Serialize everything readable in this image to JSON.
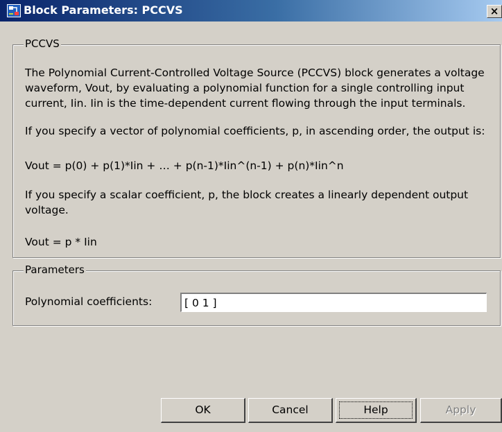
{
  "window": {
    "title": "Block Parameters: PCCVS",
    "close_glyph": "×"
  },
  "description_group": {
    "legend": "PCCVS",
    "lines": [
      "The Polynomial Current-Controlled Voltage Source (PCCVS) block generates a voltage",
      "waveform, Vout, by evaluating a polynomial function for a single controlling input",
      "current, Iin. Iin is the time-dependent current flowing through the input terminals.",
      "If you specify a vector of polynomial coefficients, p, in ascending order, the output is:",
      "Vout = p(0) + p(1)*Iin + … + p(n-1)*Iin^(n-1) +  p(n)*Iin^n",
      "If you specify a scalar coefficient, p, the block creates a linearly dependent output",
      "voltage.",
      "Vout = p * Iin"
    ]
  },
  "parameters_group": {
    "legend": "Parameters",
    "coeff_label": "Polynomial coefficients:",
    "coeff_value": "[ 0 1 ]"
  },
  "buttons": {
    "ok": "OK",
    "cancel": "Cancel",
    "help": "Help",
    "apply": "Apply"
  },
  "colors": {
    "dialog_bg": "#d4d0c8",
    "title_start": "#0a246a",
    "title_end": "#a6caf0"
  },
  "icons": {
    "title": "simulink-block-icon",
    "close": "close-icon"
  }
}
